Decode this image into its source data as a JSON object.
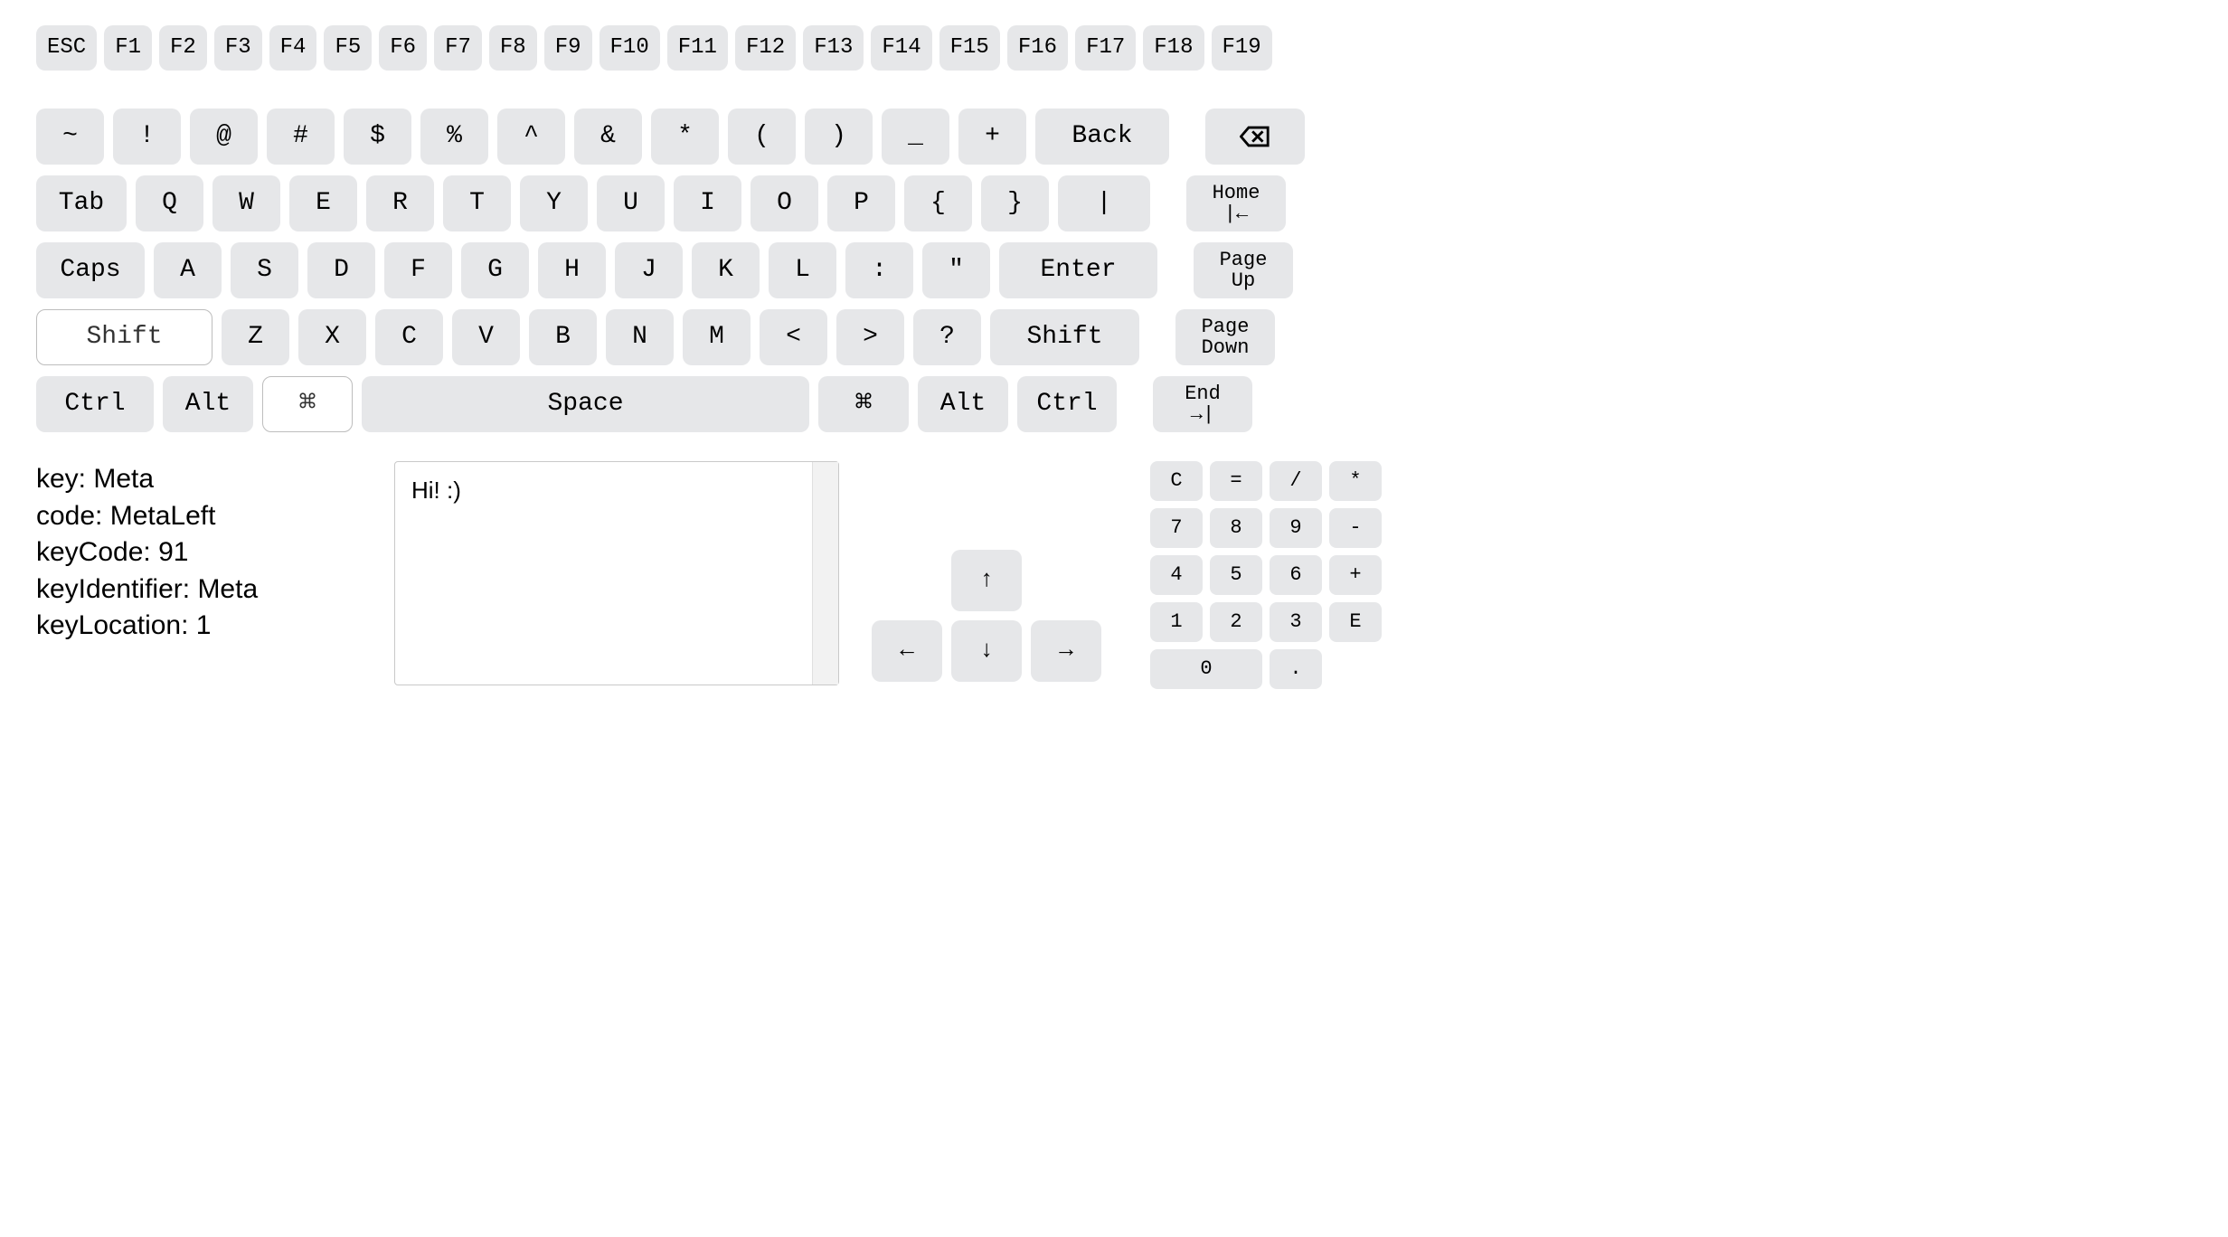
{
  "fn_row": [
    "ESC",
    "F1",
    "F2",
    "F3",
    "F4",
    "F5",
    "F6",
    "F7",
    "F8",
    "F9",
    "F10",
    "F11",
    "F12",
    "F13",
    "F14",
    "F15",
    "F16",
    "F17",
    "F18",
    "F19"
  ],
  "row1": {
    "keys": [
      "~",
      "!",
      "@",
      "#",
      "$",
      "%",
      "^",
      "&",
      "*",
      "(",
      ")",
      "_",
      "+"
    ],
    "back": "Back",
    "clear_icon": "clear-icon"
  },
  "row2": {
    "tab": "Tab",
    "keys": [
      "Q",
      "W",
      "E",
      "R",
      "T",
      "Y",
      "U",
      "I",
      "O",
      "P",
      "{",
      "}",
      "|"
    ],
    "home": {
      "label": "Home",
      "icon": "|←"
    }
  },
  "row3": {
    "caps": "Caps",
    "keys": [
      "A",
      "S",
      "D",
      "F",
      "G",
      "H",
      "J",
      "K",
      "L",
      ":",
      "\""
    ],
    "enter": "Enter",
    "pageup": {
      "l1": "Page",
      "l2": "Up"
    }
  },
  "row4": {
    "shiftL": "Shift",
    "keys": [
      "Z",
      "X",
      "C",
      "V",
      "B",
      "N",
      "M",
      "<",
      ">",
      "?"
    ],
    "shiftR": "Shift",
    "pagedown": {
      "l1": "Page",
      "l2": "Down"
    }
  },
  "row5": {
    "ctrlL": "Ctrl",
    "altL": "Alt",
    "cmdL": "⌘",
    "space": "Space",
    "cmdR": "⌘",
    "altR": "Alt",
    "ctrlR": "Ctrl",
    "end": {
      "label": "End",
      "icon": "→|"
    }
  },
  "info": {
    "key_label": "key:",
    "key_value": "Meta",
    "code_label": "code:",
    "code_value": "MetaLeft",
    "keycode_label": "keyCode:",
    "keycode_value": "91",
    "keyid_label": "keyIdentifier:",
    "keyid_value": "Meta",
    "keyloc_label": "keyLocation:",
    "keyloc_value": "1"
  },
  "textarea_value": "Hi! :)",
  "arrows": {
    "up": "↑",
    "left": "←",
    "down": "↓",
    "right": "→"
  },
  "numpad": [
    [
      "C",
      "=",
      "/",
      "*"
    ],
    [
      "7",
      "8",
      "9",
      "-"
    ],
    [
      "4",
      "5",
      "6",
      "+"
    ],
    [
      "1",
      "2",
      "3",
      "E"
    ],
    [
      "0",
      "0",
      ".",
      ""
    ]
  ],
  "numpad_rows": {
    "r0": [
      "C",
      "=",
      "/",
      "*"
    ],
    "r1": [
      "7",
      "8",
      "9",
      "-"
    ],
    "r2": [
      "4",
      "5",
      "6",
      "+"
    ],
    "r3": [
      "1",
      "2",
      "3",
      "E"
    ]
  },
  "numpad_last": {
    "zero": "0",
    "dot": "."
  }
}
